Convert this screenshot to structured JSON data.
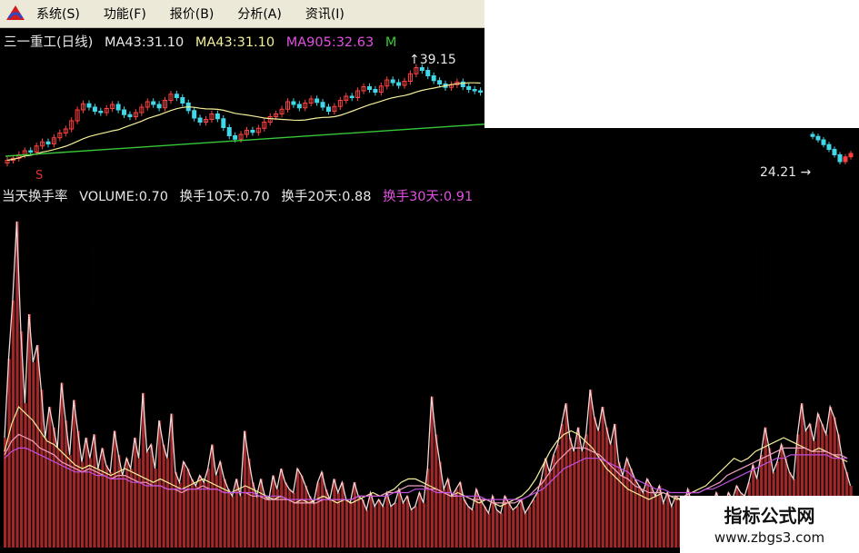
{
  "menu": {
    "items": [
      "系统(S)",
      "功能(F)",
      "报价(B)",
      "分析(A)",
      "资讯(I)"
    ]
  },
  "price_legend": {
    "name": "三一重工(日线)",
    "ma1": "MA43:31.10",
    "ma2": "MA43:31.10",
    "ma3": "MA905:32.63",
    "ma4": "M"
  },
  "volume_legend": {
    "label": "当天换手率",
    "volume": "VOLUME:0.70",
    "ma10": "换手10天:0.70",
    "ma20": "换手20天:0.88",
    "ma30": "换手30天:0.91"
  },
  "annotations": {
    "high_marker": "↑39.15",
    "low_marker": "24.21",
    "signal": "S"
  },
  "watermark": {
    "line1": "指标公式网",
    "line2": "www.zbgs3.com"
  },
  "chart_data": [
    {
      "type": "candlestick",
      "title": "三一重工(日线)",
      "y_range": [
        23,
        41
      ],
      "high": 39.15,
      "low": 24.21,
      "close_series": [
        24.8,
        25.1,
        25.6,
        26.2,
        26.0,
        26.9,
        27.5,
        27.2,
        28.1,
        28.8,
        29.4,
        30.6,
        32.2,
        33.1,
        32.6,
        32.0,
        31.8,
        32.4,
        33.0,
        32.2,
        31.5,
        31.2,
        31.8,
        32.6,
        33.4,
        33.0,
        32.5,
        33.6,
        34.5,
        34.0,
        33.2,
        32.1,
        31.0,
        30.4,
        30.8,
        31.6,
        30.9,
        29.6,
        28.4,
        27.9,
        28.6,
        29.2,
        28.9,
        29.5,
        30.4,
        31.2,
        31.6,
        32.3,
        33.4,
        33.0,
        32.5,
        33.2,
        33.8,
        33.3,
        32.6,
        32.0,
        32.7,
        33.6,
        34.2,
        34.0,
        35.0,
        35.6,
        35.2,
        34.8,
        35.7,
        36.6,
        36.2,
        35.8,
        36.4,
        37.5,
        38.4,
        38.0,
        37.2,
        36.5,
        36.0,
        35.5,
        35.9,
        36.3,
        35.6,
        35.2,
        35.0,
        34.8
      ],
      "right_series": [
        28.3,
        27.8,
        27.1,
        26.4,
        25.6,
        24.6,
        25.3,
        25.8
      ]
    },
    {
      "type": "bar",
      "title": "当天换手率",
      "series": [
        {
          "name": "VOLUME",
          "values": [
            3.2,
            5.5,
            7.2,
            9.5,
            6.3,
            4.2,
            6.8,
            5.4,
            5.9,
            4.6,
            3.2,
            4.1,
            3.5,
            2.9,
            4.8,
            3.7,
            2.7,
            4.3,
            3.4,
            2.5,
            3.2,
            2.6,
            3.3,
            2.3,
            2.9,
            2.4,
            2.2,
            3.4,
            2.7,
            2.1,
            2.6,
            2.3,
            3.2,
            2.6,
            4.5,
            2.8,
            3.0,
            2.3,
            3.7,
            3.0,
            2.6,
            3.9,
            2.2,
            1.9,
            2.5,
            2.3,
            2.0,
            1.8,
            2.1,
            1.9,
            2.3,
            3.0,
            2.1,
            2.5,
            2.0,
            1.7,
            1.5,
            2.0,
            1.5,
            3.4,
            2.6,
            1.9,
            1.5,
            2.0,
            1.5,
            1.4,
            2.1,
            1.7,
            2.3,
            1.9,
            1.7,
            1.6,
            2.3,
            2.1,
            1.8,
            1.5,
            1.3,
            1.9,
            2.2,
            1.7,
            1.4,
            2.0,
            1.6,
            1.9,
            1.4,
            1.3,
            1.9,
            1.5,
            1.4,
            1.1,
            1.6,
            1.2,
            1.4,
            1.2,
            1.6,
            1.2,
            1.3,
            1.7,
            1.3,
            1.5,
            1.1,
            1.2,
            1.6,
            1.3,
            2.3,
            4.4,
            3.3,
            2.5,
            1.7,
            2.0,
            1.5,
            1.7,
            1.9,
            1.4,
            1.2,
            1.1,
            1.7,
            1.4,
            1.2,
            1.0,
            1.5,
            1.1,
            1.0,
            1.5,
            1.3,
            1.1,
            1.2,
            1.4,
            1.0,
            1.2,
            1.4,
            1.6,
            2.0,
            2.6,
            2.2,
            2.7,
            3.0,
            3.6,
            4.2,
            3.2,
            2.8,
            3.5,
            2.8,
            3.3,
            4.6,
            3.8,
            3.4,
            4.1,
            3.5,
            3.0,
            3.6,
            2.5,
            2.1,
            2.6,
            2.3,
            2.0,
            1.8,
            1.6,
            2.0,
            1.8,
            1.5,
            1.8,
            1.3,
            1.6,
            1.2,
            1.5,
            1.4,
            1.2,
            1.7,
            1.3,
            1.4,
            1.1,
            1.3,
            1.4,
            1.2,
            1.6,
            1.3,
            1.2,
            1.6,
            1.4,
            1.8,
            1.6,
            1.5,
            1.9,
            2.4,
            2.0,
            2.7,
            3.5,
            2.9,
            2.2,
            2.5,
            3.0,
            2.6,
            2.2,
            2.0,
            3.3,
            4.2,
            3.4,
            3.6,
            3.1,
            3.9,
            3.6,
            3.3,
            4.1,
            3.8,
            3.3,
            2.6,
            2.2,
            1.8
          ]
        },
        {
          "name": "换手10天",
          "values": [
            2.8,
            3.6,
            4.1,
            3.9,
            3.7,
            3.4,
            3.1,
            3.0,
            2.8,
            2.6,
            2.4,
            2.3,
            2.4,
            2.3,
            2.2,
            2.1,
            2.2,
            2.3,
            2.2,
            2.1,
            2.0,
            1.9,
            2.0,
            1.9,
            1.8,
            1.7,
            1.8,
            1.9,
            2.0,
            1.9,
            1.8,
            1.7,
            1.6,
            1.7,
            1.8,
            1.7,
            1.6,
            1.5,
            1.4,
            1.5,
            1.4,
            1.3,
            1.4,
            1.3,
            1.4,
            1.5,
            1.4,
            1.3,
            1.4,
            1.3,
            1.4,
            1.5,
            1.6,
            1.5,
            1.6,
            1.7,
            1.9,
            2.0,
            2.0,
            1.9,
            1.8,
            1.7,
            1.6,
            1.5,
            1.6,
            1.5,
            1.4,
            1.3,
            1.4,
            1.3,
            1.2,
            1.3,
            1.4,
            1.5,
            1.7,
            2.0,
            2.4,
            2.8,
            3.1,
            3.3,
            3.4,
            3.3,
            3.1,
            2.9,
            2.6,
            2.3,
            2.1,
            1.9,
            1.7,
            1.6,
            1.5,
            1.4,
            1.5,
            1.6,
            1.5,
            1.4,
            1.5,
            1.6,
            1.7,
            1.8,
            2.0,
            2.2,
            2.4,
            2.6,
            2.5,
            2.6,
            2.8,
            2.9,
            3.0,
            3.1,
            3.2,
            3.1,
            3.0,
            2.9,
            2.8,
            2.9,
            2.8,
            2.7,
            2.6,
            2.5
          ]
        },
        {
          "name": "换手20天",
          "values": [
            2.7,
            3.1,
            3.3,
            3.2,
            3.1,
            2.9,
            2.8,
            2.7,
            2.5,
            2.4,
            2.3,
            2.2,
            2.3,
            2.2,
            2.1,
            2.0,
            2.1,
            2.1,
            2.0,
            1.9,
            1.9,
            1.8,
            1.8,
            1.7,
            1.7,
            1.6,
            1.7,
            1.7,
            1.8,
            1.7,
            1.7,
            1.6,
            1.6,
            1.6,
            1.6,
            1.5,
            1.5,
            1.4,
            1.4,
            1.4,
            1.4,
            1.3,
            1.3,
            1.3,
            1.3,
            1.4,
            1.4,
            1.4,
            1.4,
            1.4,
            1.5,
            1.5,
            1.5,
            1.5,
            1.6,
            1.6,
            1.7,
            1.8,
            1.8,
            1.8,
            1.7,
            1.7,
            1.6,
            1.5,
            1.5,
            1.5,
            1.4,
            1.4,
            1.4,
            1.3,
            1.3,
            1.3,
            1.3,
            1.4,
            1.5,
            1.7,
            1.9,
            2.2,
            2.5,
            2.7,
            2.9,
            2.9,
            2.9,
            2.8,
            2.7,
            2.5,
            2.3,
            2.1,
            2.0,
            1.8,
            1.7,
            1.6,
            1.6,
            1.6,
            1.5,
            1.5,
            1.5,
            1.6,
            1.6,
            1.7,
            1.8,
            1.9,
            2.1,
            2.2,
            2.3,
            2.4,
            2.5,
            2.6,
            2.7,
            2.8,
            2.9,
            2.9,
            2.9,
            2.9,
            2.8,
            2.8,
            2.8,
            2.7,
            2.7,
            2.6
          ]
        },
        {
          "name": "换手30天",
          "values": [
            2.6,
            2.8,
            2.9,
            2.9,
            2.8,
            2.7,
            2.6,
            2.5,
            2.4,
            2.3,
            2.2,
            2.2,
            2.2,
            2.1,
            2.1,
            2.0,
            2.0,
            2.0,
            1.9,
            1.9,
            1.8,
            1.8,
            1.8,
            1.7,
            1.7,
            1.7,
            1.7,
            1.7,
            1.7,
            1.7,
            1.7,
            1.6,
            1.6,
            1.6,
            1.6,
            1.6,
            1.5,
            1.5,
            1.5,
            1.5,
            1.4,
            1.4,
            1.4,
            1.4,
            1.4,
            1.4,
            1.4,
            1.4,
            1.4,
            1.4,
            1.5,
            1.5,
            1.5,
            1.5,
            1.5,
            1.6,
            1.6,
            1.6,
            1.7,
            1.7,
            1.7,
            1.6,
            1.6,
            1.6,
            1.5,
            1.5,
            1.5,
            1.5,
            1.4,
            1.4,
            1.4,
            1.4,
            1.4,
            1.4,
            1.5,
            1.6,
            1.7,
            1.9,
            2.1,
            2.3,
            2.4,
            2.5,
            2.6,
            2.6,
            2.6,
            2.5,
            2.4,
            2.3,
            2.2,
            2.0,
            1.9,
            1.8,
            1.7,
            1.7,
            1.6,
            1.6,
            1.6,
            1.6,
            1.6,
            1.7,
            1.7,
            1.8,
            1.9,
            2.0,
            2.1,
            2.2,
            2.3,
            2.4,
            2.5,
            2.6,
            2.6,
            2.7,
            2.7,
            2.7,
            2.7,
            2.7,
            2.7,
            2.6,
            2.6,
            2.6
          ]
        }
      ]
    }
  ]
}
